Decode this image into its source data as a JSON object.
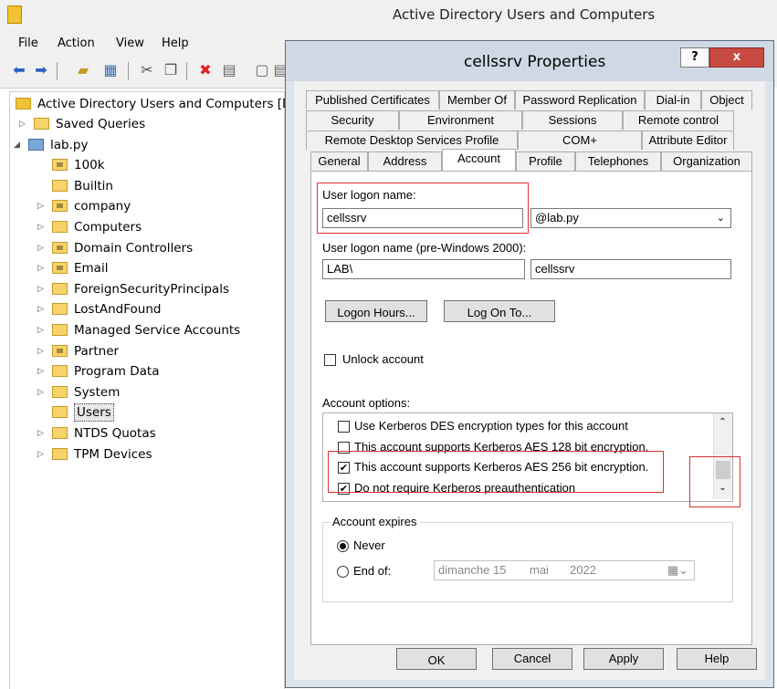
{
  "window": {
    "title": "Active Directory Users and Computers"
  },
  "menu": [
    "File",
    "Action",
    "View",
    "Help"
  ],
  "tree": {
    "root": "Active Directory Users and Computers [D",
    "items": [
      {
        "label": "Saved Queries",
        "expander": "collapsed",
        "special": false
      },
      {
        "label": "lab.py",
        "expander": "expanded",
        "special": false
      },
      {
        "label": "100k",
        "expander": "none",
        "special": true
      },
      {
        "label": "Builtin",
        "expander": "none",
        "special": false
      },
      {
        "label": "company",
        "expander": "collapsed",
        "special": true
      },
      {
        "label": "Computers",
        "expander": "collapsed",
        "special": false
      },
      {
        "label": "Domain Controllers",
        "expander": "collapsed",
        "special": true
      },
      {
        "label": "Email",
        "expander": "collapsed",
        "special": true
      },
      {
        "label": "ForeignSecurityPrincipals",
        "expander": "collapsed",
        "special": false
      },
      {
        "label": "LostAndFound",
        "expander": "collapsed",
        "special": false
      },
      {
        "label": "Managed Service Accounts",
        "expander": "collapsed",
        "special": false
      },
      {
        "label": "Partner",
        "expander": "collapsed",
        "special": true
      },
      {
        "label": "Program Data",
        "expander": "collapsed",
        "special": false
      },
      {
        "label": "System",
        "expander": "collapsed",
        "special": false
      },
      {
        "label": "Users",
        "expander": "none",
        "special": false
      },
      {
        "label": "NTDS Quotas",
        "expander": "collapsed",
        "special": false
      },
      {
        "label": "TPM Devices",
        "expander": "collapsed",
        "special": false
      }
    ]
  },
  "dialog": {
    "title": "cellssrv Properties",
    "help_label": "?",
    "close_label": "x",
    "tabs_row1": [
      "Published Certificates",
      "Member Of",
      "Password Replication",
      "Dial-in",
      "Object"
    ],
    "tabs_row2": [
      "Security",
      "Environment",
      "Sessions",
      "Remote control"
    ],
    "tabs_row3": [
      "Remote Desktop Services Profile",
      "COM+",
      "Attribute Editor"
    ],
    "tabs_row4": [
      "General",
      "Address",
      "Account",
      "Profile",
      "Telephones",
      "Organization"
    ],
    "active_tab": "Account",
    "logon_name_label": "User logon name:",
    "logon_name_value": "cellssrv",
    "domain_suffix": "@lab.py",
    "pre2000_label": "User logon name (pre-Windows 2000):",
    "pre2000_domain": "LAB\\",
    "pre2000_user": "cellssrv",
    "logon_hours_label": "Logon Hours...",
    "log_on_to_label": "Log On To...",
    "unlock_label": "Unlock account",
    "options_label": "Account options:",
    "options": [
      {
        "label": "Use Kerberos DES encryption types for this account",
        "checked": false
      },
      {
        "label": "This account supports Kerberos AES 128 bit encryption.",
        "checked": false
      },
      {
        "label": "This account supports Kerberos AES 256 bit encryption.",
        "checked": true
      },
      {
        "label": "Do not require Kerberos preauthentication",
        "checked": true
      }
    ],
    "expires_label": "Account expires",
    "never_label": "Never",
    "end_of_label": "End of:",
    "date_day": "dimanche 15",
    "date_month": "mai",
    "date_year": "2022",
    "buttons": {
      "ok": "OK",
      "cancel": "Cancel",
      "apply": "Apply",
      "help": "Help"
    }
  }
}
